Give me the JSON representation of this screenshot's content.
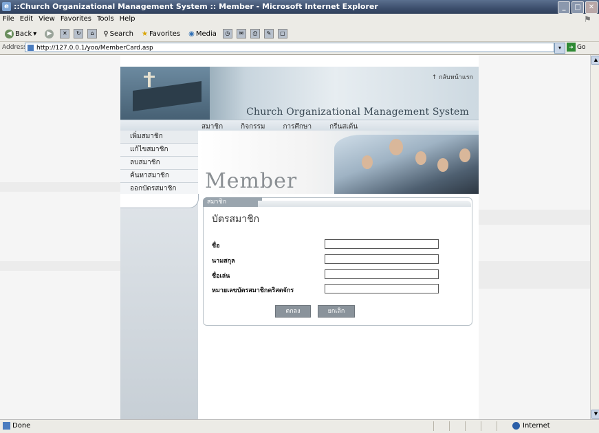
{
  "window": {
    "title": "::Church Organizational Management System :: Member - Microsoft Internet Explorer"
  },
  "menu": [
    "File",
    "Edit",
    "View",
    "Favorites",
    "Tools",
    "Help"
  ],
  "toolbar": {
    "back": "Back",
    "search": "Search",
    "favorites": "Favorites",
    "media": "Media"
  },
  "address": {
    "label": "Address",
    "url": "http://127.0.0.1/yoo/MemberCard.asp",
    "go": "Go"
  },
  "site": {
    "top_link": "↑ กลับหน้าแรก",
    "system_name": "Church Organizational Management System",
    "nav": [
      "สมาชิก",
      "กิจกรรม",
      "การศึกษา",
      "กรีนสเต้น"
    ],
    "side_menu": [
      "เพิ่มสมาชิก",
      "แก้ไขสมาชิก",
      "ลบสมาชิก",
      "ค้นหาสมาชิก",
      "ออกบัตรสมาชิก"
    ],
    "hero_title": "Member"
  },
  "form": {
    "tab": "สมาชิก",
    "heading": "บัตรสมาชิก",
    "fields": [
      {
        "label": "ชื่อ",
        "value": ""
      },
      {
        "label": "นามสกุล",
        "value": ""
      },
      {
        "label": "ชื่อเล่น",
        "value": ""
      },
      {
        "label": "หมายเลขบัตรสมาชิกคริสตจักร",
        "value": ""
      }
    ],
    "submit": "ตกลง",
    "reset": "ยกเลิก"
  },
  "status": {
    "left": "Done",
    "zone": "Internet"
  },
  "colors": {
    "titlebar": "#3d4f6d",
    "panel_tab": "#9aa5ae",
    "button": "#8a939b"
  }
}
